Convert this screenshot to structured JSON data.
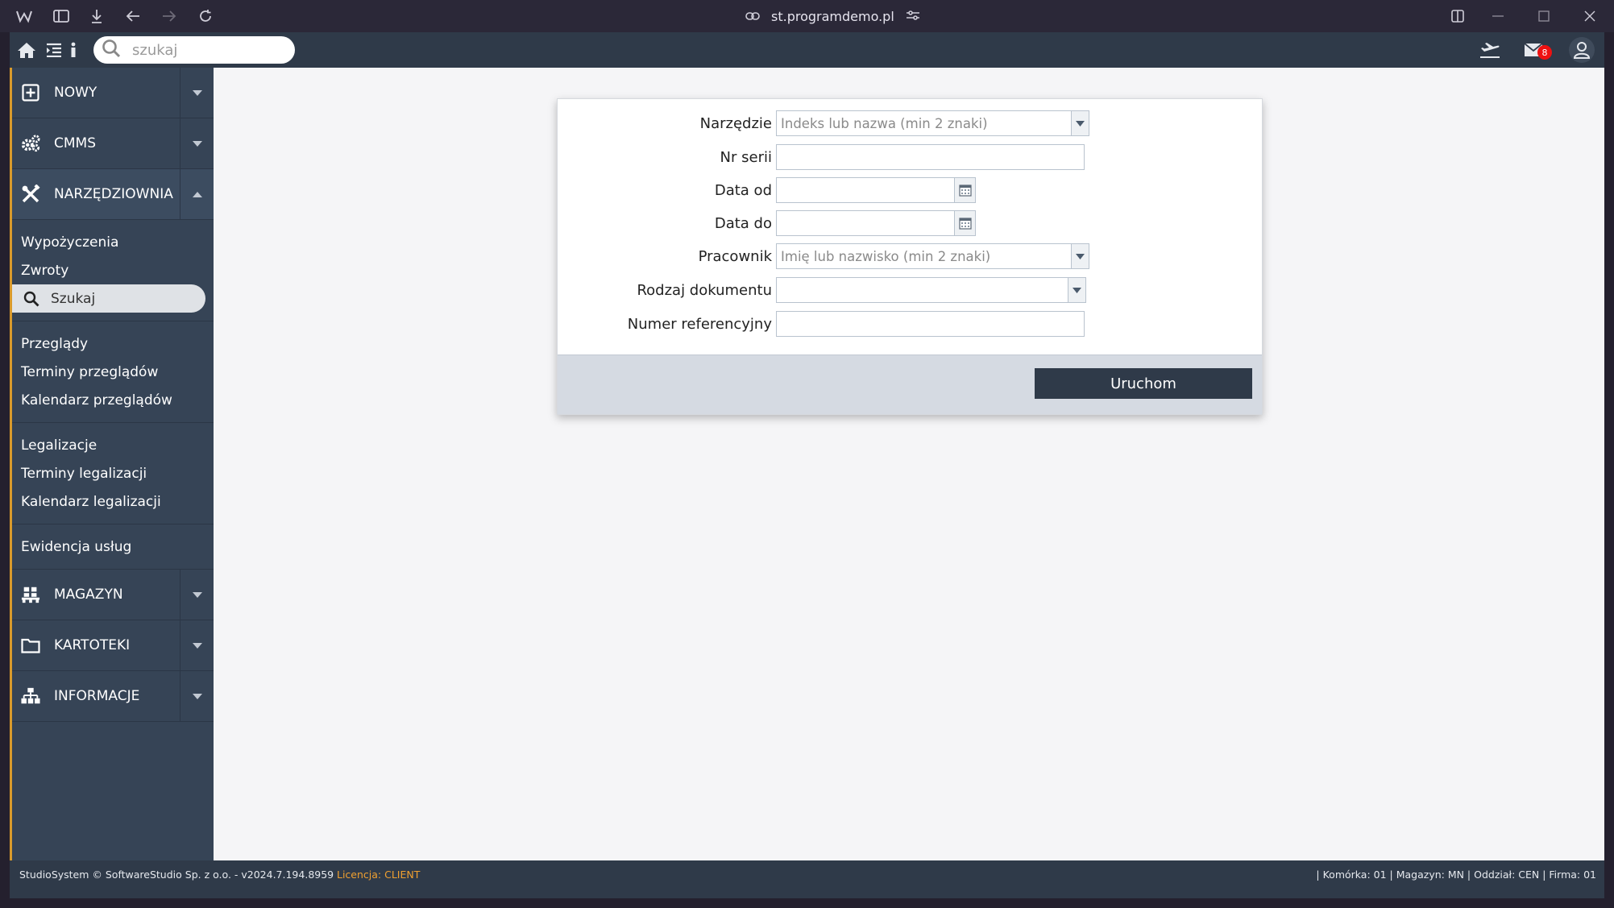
{
  "browser": {
    "url": "st.programdemo.pl"
  },
  "appbar": {
    "search_placeholder": "szukaj",
    "mail_count": "8"
  },
  "sidebar": {
    "sections": [
      {
        "label": "NOWY"
      },
      {
        "label": "CMMS"
      },
      {
        "label": "NARZĘDZIOWNIA"
      },
      {
        "label": "MAGAZYN"
      },
      {
        "label": "KARTOTEKI"
      },
      {
        "label": "INFORMACJE"
      }
    ],
    "narzedziownia_items": {
      "group1": [
        "Wypożyczenia",
        "Zwroty",
        "Szukaj"
      ],
      "group2": [
        "Przeglądy",
        "Terminy przeglądów",
        "Kalendarz przeglądów"
      ],
      "group3": [
        "Legalizacje",
        "Terminy legalizacji",
        "Kalendarz legalizacji"
      ],
      "group4": [
        "Ewidencja usług"
      ]
    }
  },
  "form": {
    "fields": [
      {
        "label": "Narzędzie",
        "placeholder": "Indeks lub nazwa (min 2 znaki)"
      },
      {
        "label": "Nr serii",
        "placeholder": ""
      },
      {
        "label": "Data od",
        "placeholder": ""
      },
      {
        "label": "Data do",
        "placeholder": ""
      },
      {
        "label": "Pracownik",
        "placeholder": "Imię lub nazwisko (min 2 znaki)"
      },
      {
        "label": "Rodzaj dokumentu",
        "placeholder": ""
      },
      {
        "label": "Numer referencyjny",
        "placeholder": ""
      }
    ],
    "run_label": "Uruchom"
  },
  "footer": {
    "left": "StudioSystem © SoftwareStudio Sp. z o.o. - v2024.7.194.8959",
    "license": "Licencja: CLIENT",
    "right": "| Komórka: 01 | Magazyn: MN | Oddział: CEN | Firma: 01"
  },
  "colors": {
    "accent": "#d99a2b",
    "sidebar": "#364456",
    "appbar": "#2f3a49",
    "badge": "#ee1111"
  }
}
